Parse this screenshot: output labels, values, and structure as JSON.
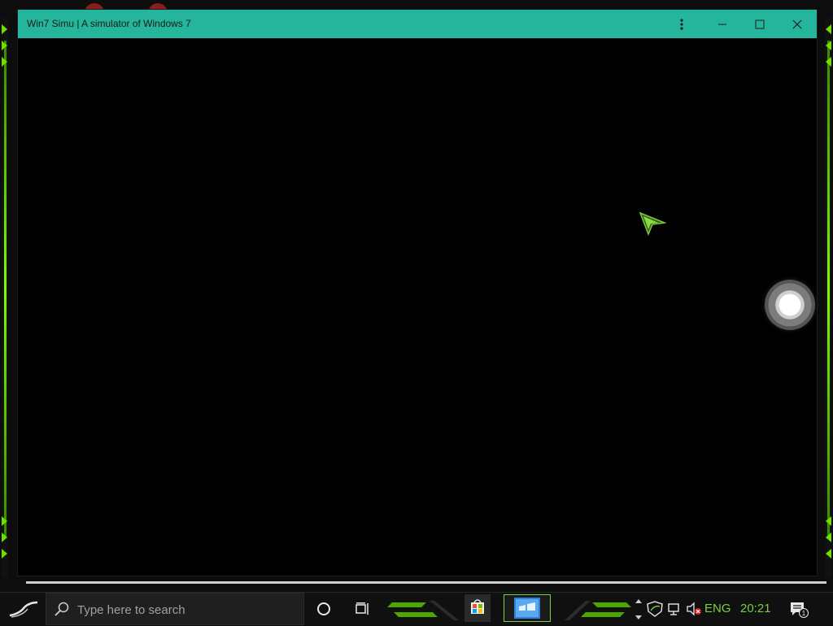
{
  "window": {
    "title": "Win7 Simu | A simulator of Windows 7",
    "menu_icon": "kebab-menu-icon",
    "minimize_icon": "minimize-icon",
    "maximize_icon": "maximize-icon",
    "close_icon": "close-icon"
  },
  "taskbar": {
    "search_placeholder": "Type here to search",
    "language": "ENG",
    "time": "20:21",
    "notification_count": "1",
    "pinned_apps": [
      "store-app",
      "win7-simu-app"
    ]
  },
  "colors": {
    "titlebar": "#24b59c",
    "accent": "#7ad13c",
    "frame_green": "#6ee000"
  }
}
